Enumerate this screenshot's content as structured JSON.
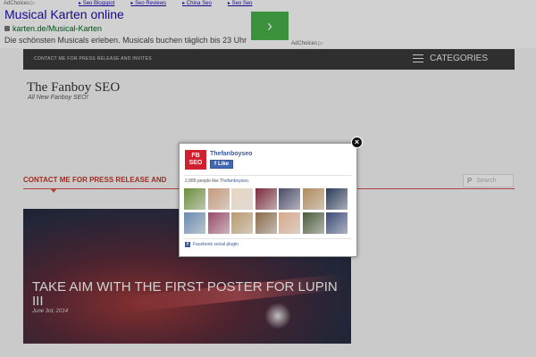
{
  "ad": {
    "adchoices_top": "AdChoices ▷",
    "links": [
      "Seo Blogspot",
      "Seo Reviews",
      "China Seo",
      "Seo Seo"
    ],
    "title": "Musical Karten online",
    "url": "karten.de/Musical-Karten",
    "description": "Die schönsten Musicals erleben. Musicals buchen täglich bis 23 Uhr",
    "arrow": "›",
    "adchoices_bottom": "AdChoices ▷",
    "arrow_color": "#4ab34a"
  },
  "nav": {
    "link": "CONTACT ME FOR PRESS RELEASE AND INVITES",
    "categories": "CATEGORIES"
  },
  "site": {
    "title": "The Fanboy SEO",
    "tagline": "All New Fanboy SEO!"
  },
  "section": {
    "heading": "CONTACT ME FOR PRESS RELEASE AND",
    "search_placeholder": "Search",
    "search_icon": "P",
    "accent": "#c0392b"
  },
  "post": {
    "title": "TAKE AIM WITH THE FIRST POSTER FOR LUPIN III",
    "date": "June 3rd, 2014"
  },
  "fb": {
    "page_name": "Thefanboyseo",
    "logo_text": "FB SEO",
    "like_label": "Like",
    "count_text": "2,889 people like",
    "count_page": "Thefanboyseo.",
    "plugin_label": "Facebook social plugin",
    "close": "×",
    "faces": [
      "#6b8e3a",
      "#c79a7a",
      "#e8d5c0",
      "#7a2a3a",
      "#4a4a6a",
      "#b08a5a",
      "#2a3a5a",
      "#6a8ab0",
      "#9a4a6a",
      "#b89a6a",
      "#8a6a4a",
      "#d8a88a",
      "#4a5a3a",
      "#3a4a7a"
    ]
  }
}
